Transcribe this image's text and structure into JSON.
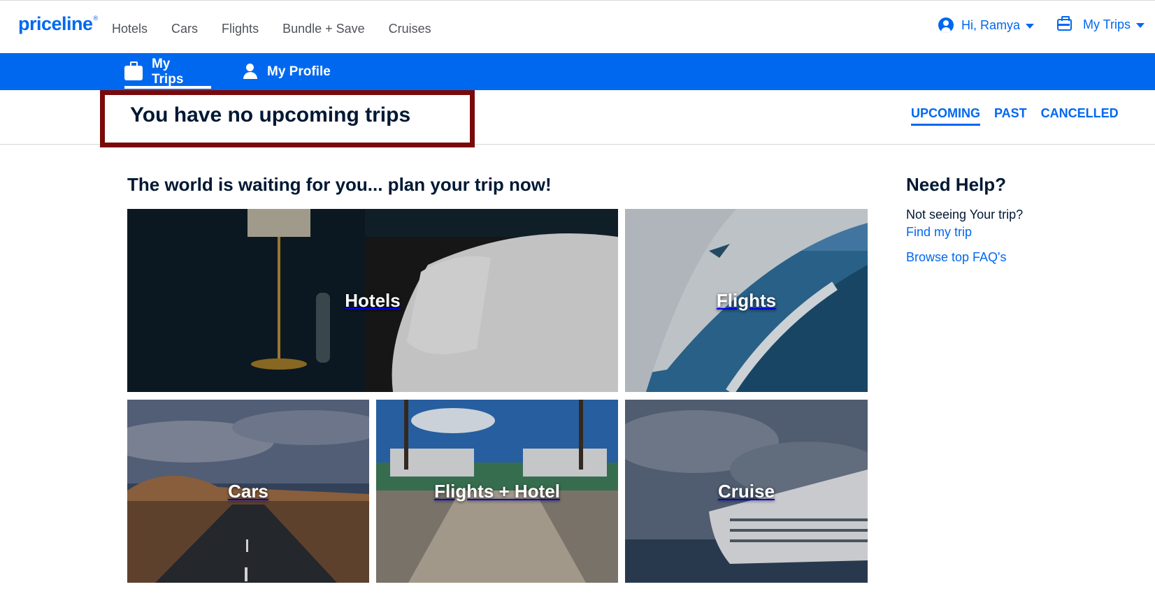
{
  "brand": {
    "name": "priceline",
    "mark": "®",
    "color": "#0068ef"
  },
  "nav": {
    "items": [
      "Hotels",
      "Cars",
      "Flights",
      "Bundle + Save",
      "Cruises"
    ]
  },
  "account": {
    "greeting": "Hi, Ramya",
    "trips_label": "My Trips"
  },
  "subnav": {
    "tabs": [
      {
        "label": "My Trips",
        "icon": "briefcase-icon",
        "active": true
      },
      {
        "label": "My Profile",
        "icon": "person-icon",
        "active": false
      }
    ]
  },
  "page": {
    "title": "You have no upcoming trips",
    "highlight_color": "#7a0a0a"
  },
  "filters": {
    "items": [
      {
        "label": "UPCOMING",
        "active": true
      },
      {
        "label": "PAST",
        "active": false
      },
      {
        "label": "CANCELLED",
        "active": false
      }
    ]
  },
  "main": {
    "tagline": "The world is waiting for you... plan your trip now!",
    "tiles": [
      "Hotels",
      "Flights",
      "Cars",
      "Flights + Hotel",
      "Cruise"
    ]
  },
  "help": {
    "title": "Need Help?",
    "text": "Not seeing Your trip?",
    "find_link": "Find my trip",
    "faq_link": "Browse top FAQ's"
  }
}
